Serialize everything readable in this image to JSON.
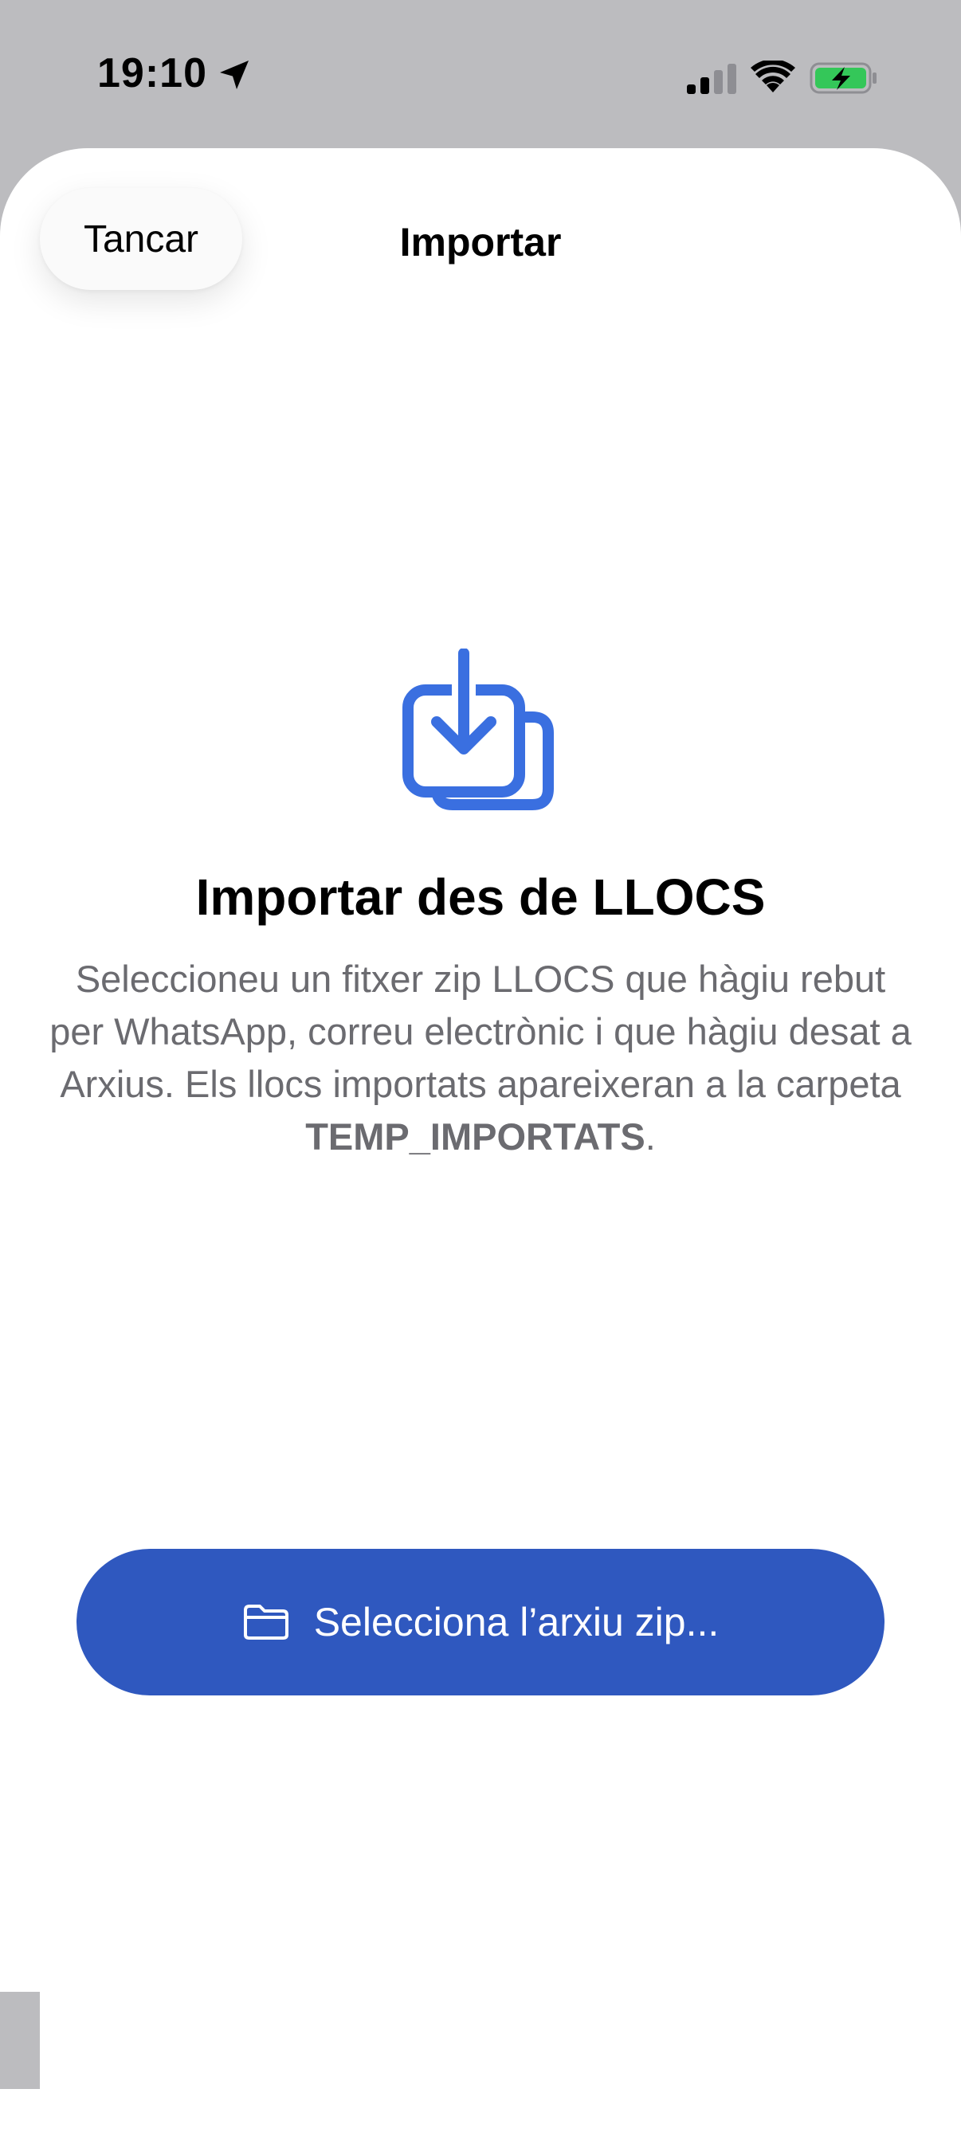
{
  "status_bar": {
    "time": "19:10",
    "location_icon": "location-arrow-icon",
    "signal_icon": "cellular-signal-icon",
    "wifi_icon": "wifi-icon",
    "battery_icon": "battery-charging-icon",
    "battery_color": "#34c759"
  },
  "sheet": {
    "close_label": "Tancar",
    "title": "Importar"
  },
  "content": {
    "icon": "import-download-icon",
    "icon_color": "#3a6fe0",
    "heading": "Importar des de LLOCS",
    "description_prefix": "Seleccioneu un fitxer zip LLOCS que hàgiu rebut per WhatsApp, correu electrònic i que hàgiu desat a Arxius. Els llocs importats apareixeran a la carpeta ",
    "description_bold": "TEMP_IMPORTATS",
    "description_suffix": "."
  },
  "action": {
    "icon": "folder-icon",
    "label": "Selecciona l’arxiu zip...",
    "color": "#2f58bf"
  }
}
